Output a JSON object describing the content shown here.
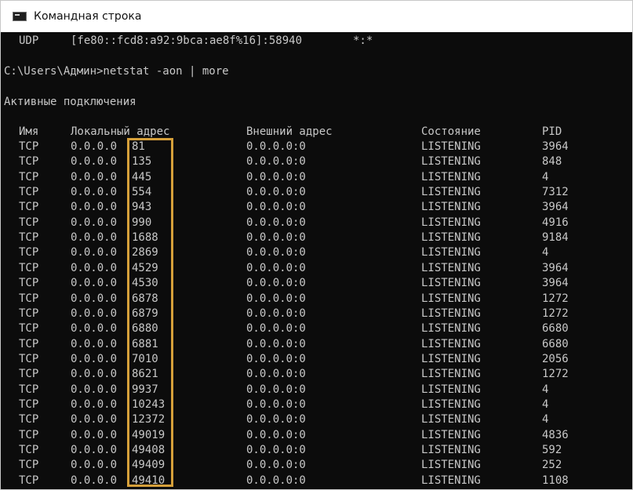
{
  "window": {
    "title": "Командная строка"
  },
  "console": {
    "udp_line": {
      "proto": "UDP",
      "local": "[fe80::fcd8:a92:9bca:ae8f%16]:58940",
      "foreign": "*:*"
    },
    "prompt": "C:\\Users\\Админ>netstat -aon | more",
    "section_title": "Активные подключения",
    "headers": {
      "name": "Имя",
      "local": "Локальный адрес",
      "foreign": "Внешний адрес",
      "state": "Состояние",
      "pid": "PID"
    },
    "rows": [
      {
        "proto": "TCP",
        "ip": "0.0.0.0",
        "port": "81",
        "foreign": "0.0.0.0:0",
        "state": "LISTENING",
        "pid": "3964"
      },
      {
        "proto": "TCP",
        "ip": "0.0.0.0",
        "port": "135",
        "foreign": "0.0.0.0:0",
        "state": "LISTENING",
        "pid": "848"
      },
      {
        "proto": "TCP",
        "ip": "0.0.0.0",
        "port": "445",
        "foreign": "0.0.0.0:0",
        "state": "LISTENING",
        "pid": "4"
      },
      {
        "proto": "TCP",
        "ip": "0.0.0.0",
        "port": "554",
        "foreign": "0.0.0.0:0",
        "state": "LISTENING",
        "pid": "7312"
      },
      {
        "proto": "TCP",
        "ip": "0.0.0.0",
        "port": "943",
        "foreign": "0.0.0.0:0",
        "state": "LISTENING",
        "pid": "3964"
      },
      {
        "proto": "TCP",
        "ip": "0.0.0.0",
        "port": "990",
        "foreign": "0.0.0.0:0",
        "state": "LISTENING",
        "pid": "4916"
      },
      {
        "proto": "TCP",
        "ip": "0.0.0.0",
        "port": "1688",
        "foreign": "0.0.0.0:0",
        "state": "LISTENING",
        "pid": "9184"
      },
      {
        "proto": "TCP",
        "ip": "0.0.0.0",
        "port": "2869",
        "foreign": "0.0.0.0:0",
        "state": "LISTENING",
        "pid": "4"
      },
      {
        "proto": "TCP",
        "ip": "0.0.0.0",
        "port": "4529",
        "foreign": "0.0.0.0:0",
        "state": "LISTENING",
        "pid": "3964"
      },
      {
        "proto": "TCP",
        "ip": "0.0.0.0",
        "port": "4530",
        "foreign": "0.0.0.0:0",
        "state": "LISTENING",
        "pid": "3964"
      },
      {
        "proto": "TCP",
        "ip": "0.0.0.0",
        "port": "6878",
        "foreign": "0.0.0.0:0",
        "state": "LISTENING",
        "pid": "1272"
      },
      {
        "proto": "TCP",
        "ip": "0.0.0.0",
        "port": "6879",
        "foreign": "0.0.0.0:0",
        "state": "LISTENING",
        "pid": "1272"
      },
      {
        "proto": "TCP",
        "ip": "0.0.0.0",
        "port": "6880",
        "foreign": "0.0.0.0:0",
        "state": "LISTENING",
        "pid": "6680"
      },
      {
        "proto": "TCP",
        "ip": "0.0.0.0",
        "port": "6881",
        "foreign": "0.0.0.0:0",
        "state": "LISTENING",
        "pid": "6680"
      },
      {
        "proto": "TCP",
        "ip": "0.0.0.0",
        "port": "7010",
        "foreign": "0.0.0.0:0",
        "state": "LISTENING",
        "pid": "2056"
      },
      {
        "proto": "TCP",
        "ip": "0.0.0.0",
        "port": "8621",
        "foreign": "0.0.0.0:0",
        "state": "LISTENING",
        "pid": "1272"
      },
      {
        "proto": "TCP",
        "ip": "0.0.0.0",
        "port": "9937",
        "foreign": "0.0.0.0:0",
        "state": "LISTENING",
        "pid": "4"
      },
      {
        "proto": "TCP",
        "ip": "0.0.0.0",
        "port": "10243",
        "foreign": "0.0.0.0:0",
        "state": "LISTENING",
        "pid": "4"
      },
      {
        "proto": "TCP",
        "ip": "0.0.0.0",
        "port": "12372",
        "foreign": "0.0.0.0:0",
        "state": "LISTENING",
        "pid": "4"
      },
      {
        "proto": "TCP",
        "ip": "0.0.0.0",
        "port": "49019",
        "foreign": "0.0.0.0:0",
        "state": "LISTENING",
        "pid": "4836"
      },
      {
        "proto": "TCP",
        "ip": "0.0.0.0",
        "port": "49408",
        "foreign": "0.0.0.0:0",
        "state": "LISTENING",
        "pid": "592"
      },
      {
        "proto": "TCP",
        "ip": "0.0.0.0",
        "port": "49409",
        "foreign": "0.0.0.0:0",
        "state": "LISTENING",
        "pid": "252"
      },
      {
        "proto": "TCP",
        "ip": "0.0.0.0",
        "port": "49410",
        "foreign": "0.0.0.0:0",
        "state": "LISTENING",
        "pid": "1108"
      }
    ]
  },
  "highlight_color": "#d6a03a"
}
